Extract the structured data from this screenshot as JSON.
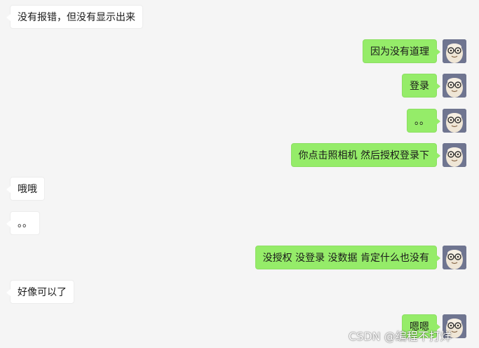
{
  "colors": {
    "background": "#f5f5f5",
    "received_bubble": "#ffffff",
    "sent_bubble": "#95ec69"
  },
  "messages": [
    {
      "side": "left",
      "text": "没有报错，但没有显示出来"
    },
    {
      "side": "right",
      "text": "因为没有道理"
    },
    {
      "side": "right",
      "text": "登录"
    },
    {
      "side": "right",
      "text": "。。"
    },
    {
      "side": "right",
      "text": "你点击照相机 然后授权登录下"
    },
    {
      "side": "left",
      "text": "哦哦"
    },
    {
      "side": "left",
      "text": "。。"
    },
    {
      "side": "right",
      "text": "没授权 没登录 没数据 肯定什么也没有"
    },
    {
      "side": "left",
      "text": "好像可以了"
    },
    {
      "side": "right",
      "text": "嗯嗯"
    }
  ],
  "avatar_icon": "cartoon-glasses-avatar-icon",
  "watermark": "CSDN @编程不打烊"
}
